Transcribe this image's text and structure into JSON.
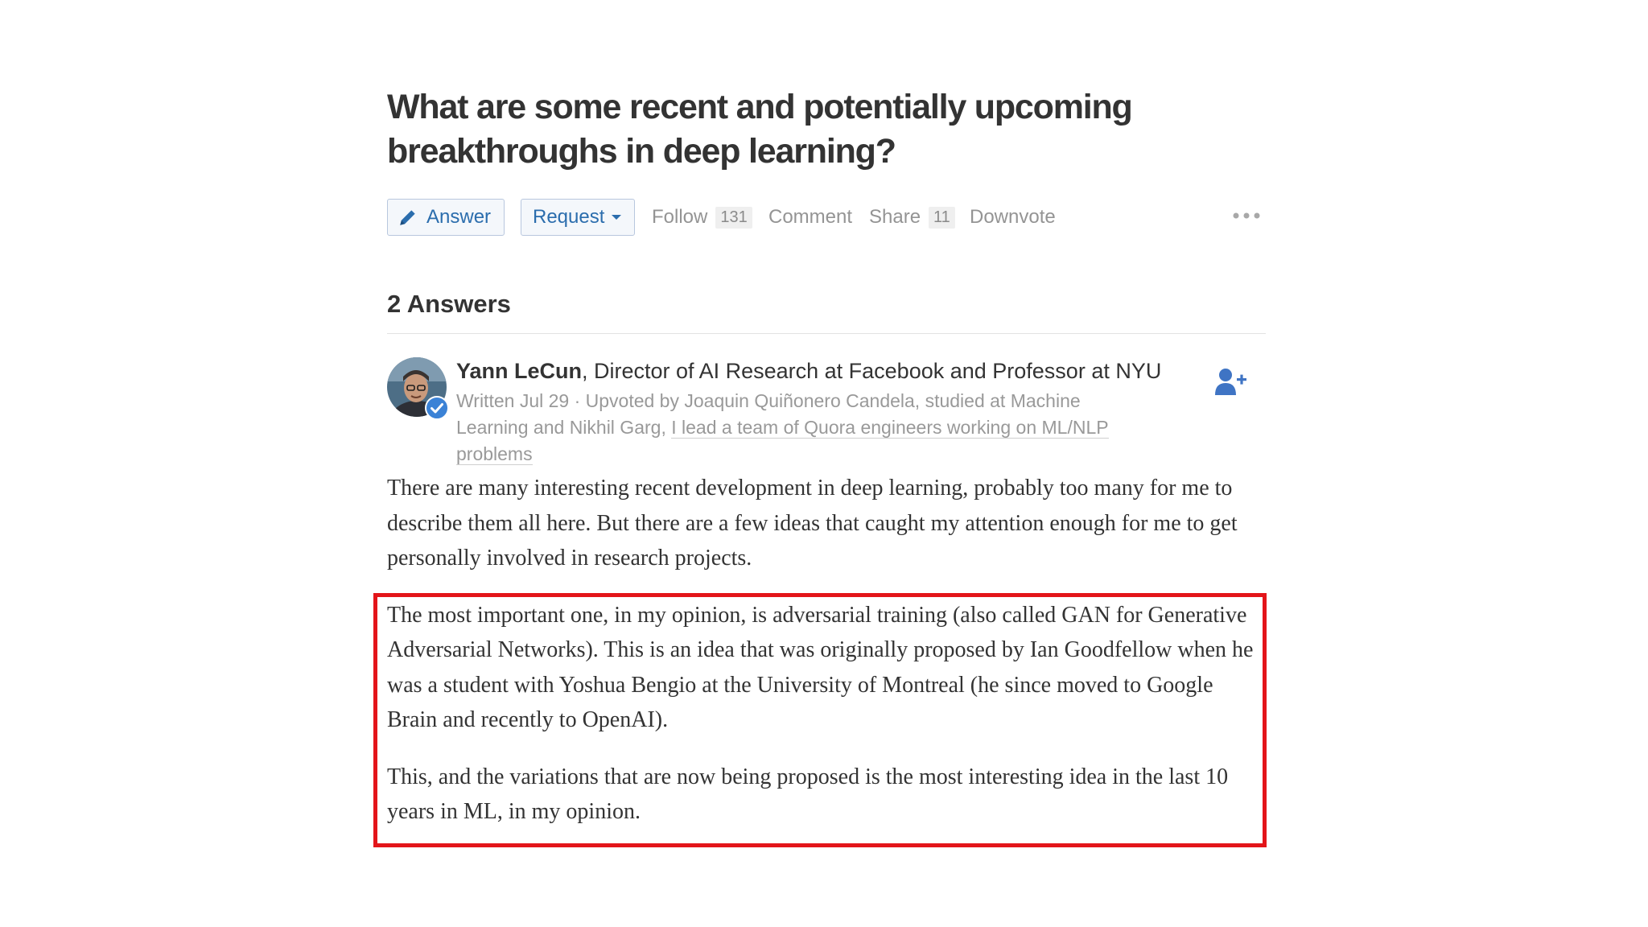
{
  "question": {
    "title": "What are some recent and potentially upcoming breakthroughs in deep learning?"
  },
  "actions": {
    "answer_label": "Answer",
    "request_label": "Request",
    "follow_label": "Follow",
    "follow_count": "131",
    "comment_label": "Comment",
    "share_label": "Share",
    "share_count": "11",
    "downvote_label": "Downvote"
  },
  "answers_header": "2 Answers",
  "answer": {
    "author_name": "Yann LeCun",
    "author_credential": ", Director of AI Research at Facebook and Professor at NYU",
    "meta_prefix": "Written Jul 29 · Upvoted by ",
    "upvoter_1": "Joaquin Quiñonero Candela, studied at Machine Learning",
    "meta_and": " and ",
    "upvoter_2_name": "Nikhil Garg, ",
    "upvoter_2_credential": "I lead a team of Quora engineers working on ML/NLP problems",
    "paragraphs": [
      "There are many interesting recent development in deep learning, probably too many for me to describe them all here. But there are a few ideas that caught my attention enough for me to get personally involved in research projects.",
      "The most important one, in my opinion, is adversarial training (also called GAN for Generative Adversarial Networks). This is an idea that was originally proposed by Ian Goodfellow when he was a student with Yoshua Bengio at the University of Montreal (he since moved to Google Brain and recently to OpenAI).",
      "This, and the variations that are now being proposed is the most interesting idea in the last 10 years in ML, in my opinion."
    ]
  },
  "colors": {
    "link_blue": "#2b6dad",
    "highlight_red": "#e3151a",
    "muted_gray": "#999999"
  }
}
